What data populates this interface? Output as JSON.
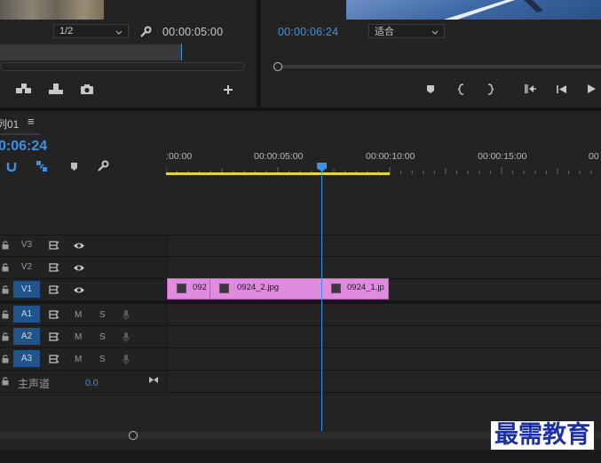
{
  "source_monitor": {
    "resolution": "1/2",
    "timecode": "00:00:05:00"
  },
  "program_monitor": {
    "timecode": "00:00:06:24",
    "fit": "适合"
  },
  "timeline": {
    "tab_title": "列01",
    "tab_menu": "≡",
    "playhead_timecode": "0:06:24",
    "ruler": [
      ":00:00",
      "00:00:05:00",
      "00:00:10:00",
      "00:00:15:00",
      "00"
    ],
    "tracks": [
      {
        "label": "V3",
        "m": "",
        "s": ""
      },
      {
        "label": "V2",
        "m": "",
        "s": ""
      },
      {
        "label": "V1",
        "m": "",
        "s": ""
      },
      {
        "label": "A1",
        "m": "M",
        "s": "S"
      },
      {
        "label": "A2",
        "m": "M",
        "s": "S"
      },
      {
        "label": "A3",
        "m": "M",
        "s": "S"
      }
    ],
    "master": {
      "label": "主声道",
      "value": "0.0"
    },
    "clips": [
      {
        "name": "092"
      },
      {
        "name": "0924_2.jpg"
      },
      {
        "name": "0924_1.jp"
      }
    ]
  },
  "watermark": "最需教育",
  "colors": {
    "accent_blue": "#3d91e6",
    "clip_pink": "#e08ae0",
    "work_area_yellow": "#e6d636",
    "active_track": "#20548a"
  }
}
